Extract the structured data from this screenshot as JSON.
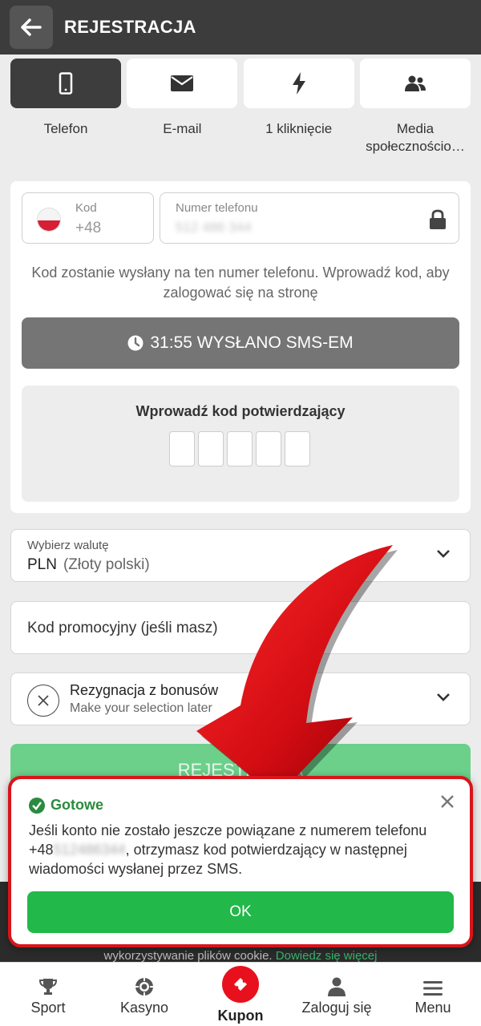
{
  "header": {
    "title": "REJESTRACJA"
  },
  "tabs": [
    {
      "label": "Telefon",
      "icon": "smartphone-icon",
      "active": true
    },
    {
      "label": "E-mail",
      "icon": "envelope-icon"
    },
    {
      "label": "1 kliknięcie",
      "icon": "lightning-icon"
    },
    {
      "label": "Media społecznościo…",
      "icon": "users-icon"
    }
  ],
  "phone": {
    "code_label": "Kod",
    "code_value": "+48",
    "number_label": "Numer telefonu",
    "number_value": "512 486 344",
    "info": "Kod zostanie wysłany na ten numer telefonu. Wprowadź kod, aby zalogować się na stronę",
    "sent_label": "31:55 WYSŁANO SMS-EM",
    "otp_title": "Wprowadź kod potwierdzający"
  },
  "currency": {
    "label": "Wybierz walutę",
    "code": "PLN",
    "name": "(Złoty polski)"
  },
  "promo": {
    "placeholder": "Kod promocyjny (jeśli masz)"
  },
  "bonus": {
    "title": "Rezygnacja z bonusów",
    "subtitle": "Make your selection later"
  },
  "register_button": "REJESTRACJA",
  "cookie": {
    "text": "wykorzystywanie plików cookie.",
    "link": "Dowiedz się więcej"
  },
  "toast": {
    "title": "Gotowe",
    "body_before": "Jeśli konto nie zostało jeszcze powiązane z numerem telefonu +48",
    "body_hidden": "512486344",
    "body_after": ", otrzymasz kod potwierdzający w następnej wiadomości wysłanej przez SMS.",
    "ok": "OK"
  },
  "nav": [
    {
      "label": "Sport",
      "icon": "trophy-icon"
    },
    {
      "label": "Kasyno",
      "icon": "casino-chip-icon"
    },
    {
      "label": "Kupon",
      "icon": "ticket-icon",
      "active": true
    },
    {
      "label": "Zaloguj się",
      "icon": "user-icon"
    },
    {
      "label": "Menu",
      "icon": "hamburger-icon"
    }
  ],
  "colors": {
    "accent": "#22b84a",
    "highlight": "#d9141b",
    "header": "#3c3c3c"
  }
}
